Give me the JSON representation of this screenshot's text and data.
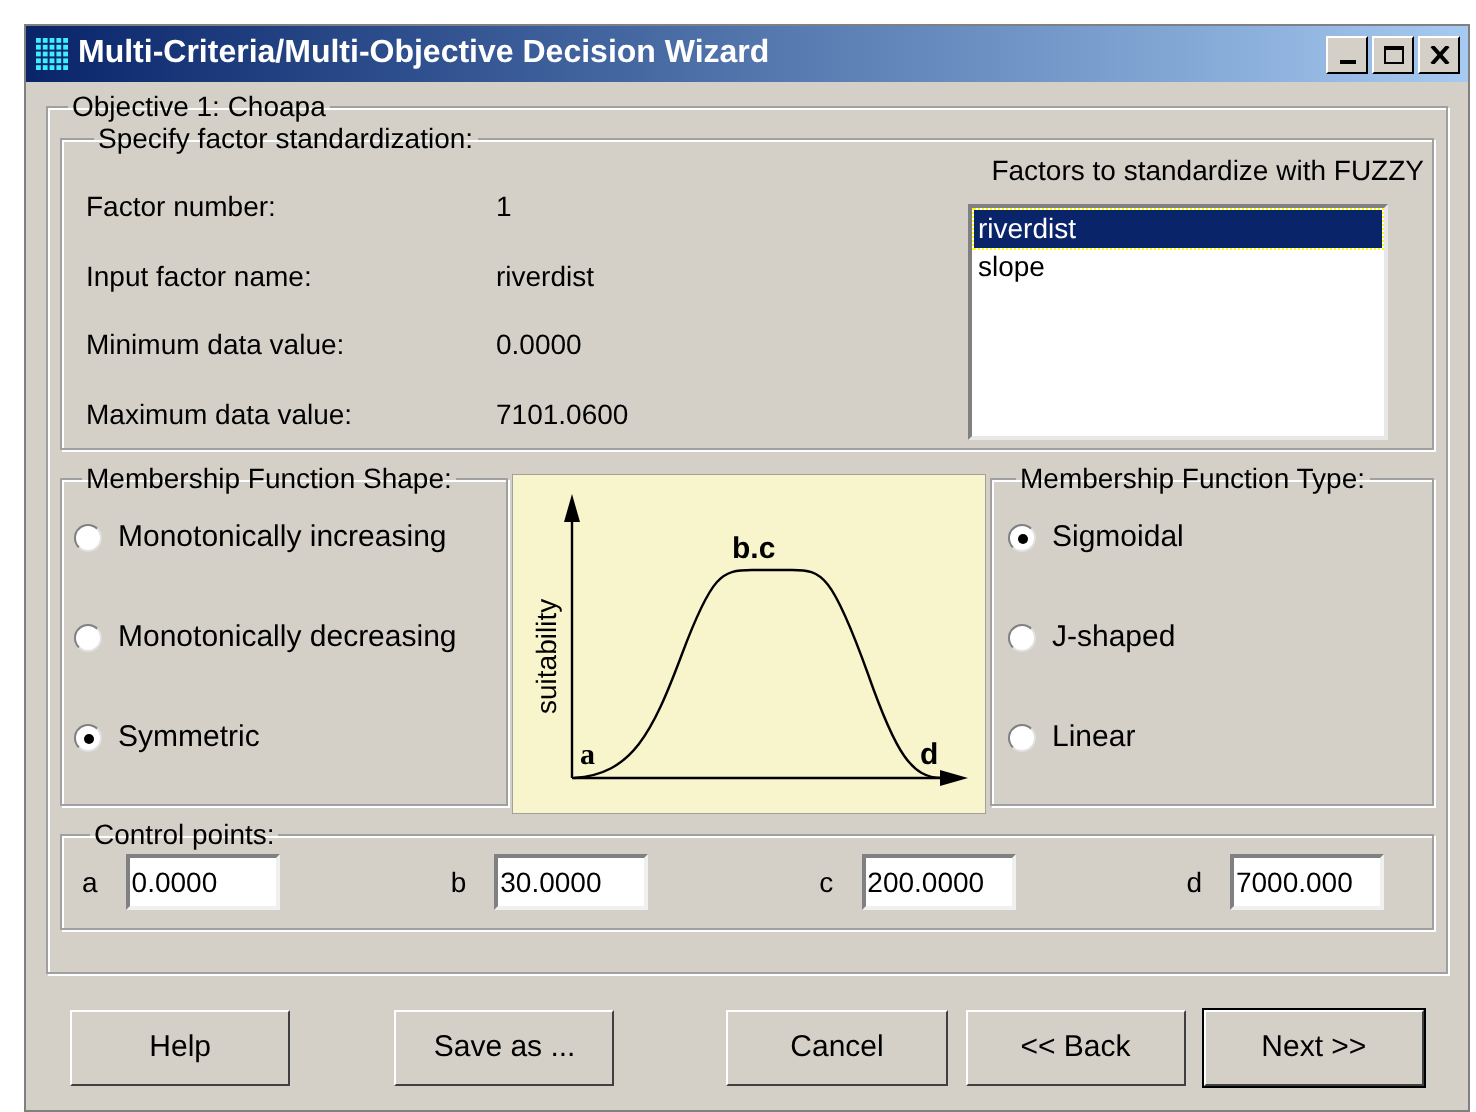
{
  "window": {
    "title": "Multi-Criteria/Multi-Objective Decision Wizard"
  },
  "objective": {
    "title": "Objective 1: Choapa",
    "standardization": {
      "title": "Specify factor standardization:",
      "fields": [
        {
          "label": "Factor number:",
          "value": "1"
        },
        {
          "label": "Input factor name:",
          "value": "riverdist"
        },
        {
          "label": "Minimum data value:",
          "value": "0.0000"
        },
        {
          "label": "Maximum data value:",
          "value": "7101.0600"
        }
      ],
      "factor_list": {
        "title": "Factors to standardize with FUZZY",
        "items": [
          {
            "label": "riverdist",
            "selected": true
          },
          {
            "label": "slope",
            "selected": false
          }
        ]
      }
    },
    "shape": {
      "title": "Membership Function Shape:",
      "options": [
        {
          "label": "Monotonically increasing",
          "selected": false
        },
        {
          "label": "Monotonically decreasing",
          "selected": false
        },
        {
          "label": "Symmetric",
          "selected": true
        }
      ]
    },
    "diagram": {
      "ylabel": "suitability",
      "point_a": "a",
      "point_bc": "b.c",
      "point_d": "d"
    },
    "type": {
      "title": "Membership Function Type:",
      "options": [
        {
          "label": "Sigmoidal",
          "selected": true
        },
        {
          "label": "J-shaped",
          "selected": false
        },
        {
          "label": "Linear",
          "selected": false
        }
      ]
    },
    "control_points": {
      "title": "Control points:",
      "points": [
        {
          "label": "a",
          "value": "0.0000"
        },
        {
          "label": "b",
          "value": "30.0000"
        },
        {
          "label": "c",
          "value": "200.0000"
        },
        {
          "label": "d",
          "value": "7000.000"
        }
      ]
    }
  },
  "buttons": [
    {
      "label": "Help",
      "default": false
    },
    {
      "label": "Save as ...",
      "default": false
    },
    {
      "label": "Cancel",
      "default": false
    },
    {
      "label": "<< Back",
      "default": false
    },
    {
      "label": "Next >>",
      "default": true
    }
  ]
}
